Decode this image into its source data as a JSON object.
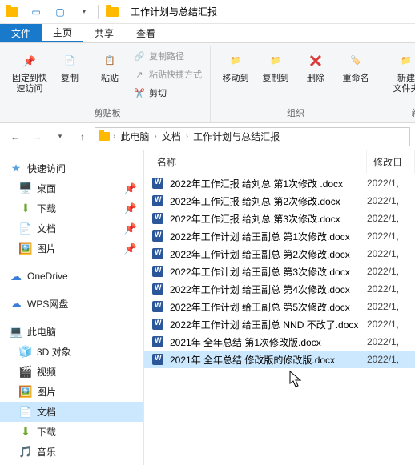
{
  "window": {
    "title": "工作计划与总结汇报"
  },
  "tabs": {
    "file": "文件",
    "home": "主页",
    "share": "共享",
    "view": "查看"
  },
  "ribbon": {
    "pin": "固定到快\n速访问",
    "copy": "复制",
    "paste": "粘贴",
    "cut": "剪切",
    "copy_path": "复制路径",
    "paste_shortcut": "粘贴快捷方式",
    "clipboard_group": "剪贴板",
    "move_to": "移动到",
    "copy_to": "复制到",
    "delete": "删除",
    "rename": "重命名",
    "organize_group": "组织",
    "new_folder": "新建\n文件夹",
    "new_group": "新"
  },
  "breadcrumb": {
    "pc": "此电脑",
    "docs": "文档",
    "folder": "工作计划与总结汇报"
  },
  "sidebar": {
    "quick": "快速访问",
    "desktop": "桌面",
    "downloads": "下载",
    "documents": "文档",
    "pictures": "图片",
    "onedrive": "OneDrive",
    "wps": "WPS网盘",
    "thispc": "此电脑",
    "objects3d": "3D 对象",
    "videos": "视频",
    "pictures2": "图片",
    "documents2": "文档",
    "downloads2": "下载",
    "music": "音乐"
  },
  "columns": {
    "name": "名称",
    "modified": "修改日"
  },
  "files": [
    {
      "name": "2022年工作汇报 给刘总 第1次修改 .docx",
      "date": "2022/1,"
    },
    {
      "name": "2022年工作汇报 给刘总 第2次修改.docx",
      "date": "2022/1,"
    },
    {
      "name": "2022年工作汇报 给刘总 第3次修改.docx",
      "date": "2022/1,"
    },
    {
      "name": "2022年工作计划 给王副总 第1次修改.docx",
      "date": "2022/1,"
    },
    {
      "name": "2022年工作计划 给王副总 第2次修改.docx",
      "date": "2022/1,"
    },
    {
      "name": "2022年工作计划 给王副总 第3次修改.docx",
      "date": "2022/1,"
    },
    {
      "name": "2022年工作计划 给王副总 第4次修改.docx",
      "date": "2022/1,"
    },
    {
      "name": "2022年工作计划 给王副总 第5次修改.docx",
      "date": "2022/1,"
    },
    {
      "name": "2022年工作计划 给王副总 NND 不改了.docx",
      "date": "2022/1,"
    },
    {
      "name": "2021年 全年总结 第1次修改版.docx",
      "date": "2022/1,"
    },
    {
      "name": "2021年 全年总结 修改版的修改版.docx",
      "date": "2022/1,"
    }
  ],
  "selected_file_index": 10
}
